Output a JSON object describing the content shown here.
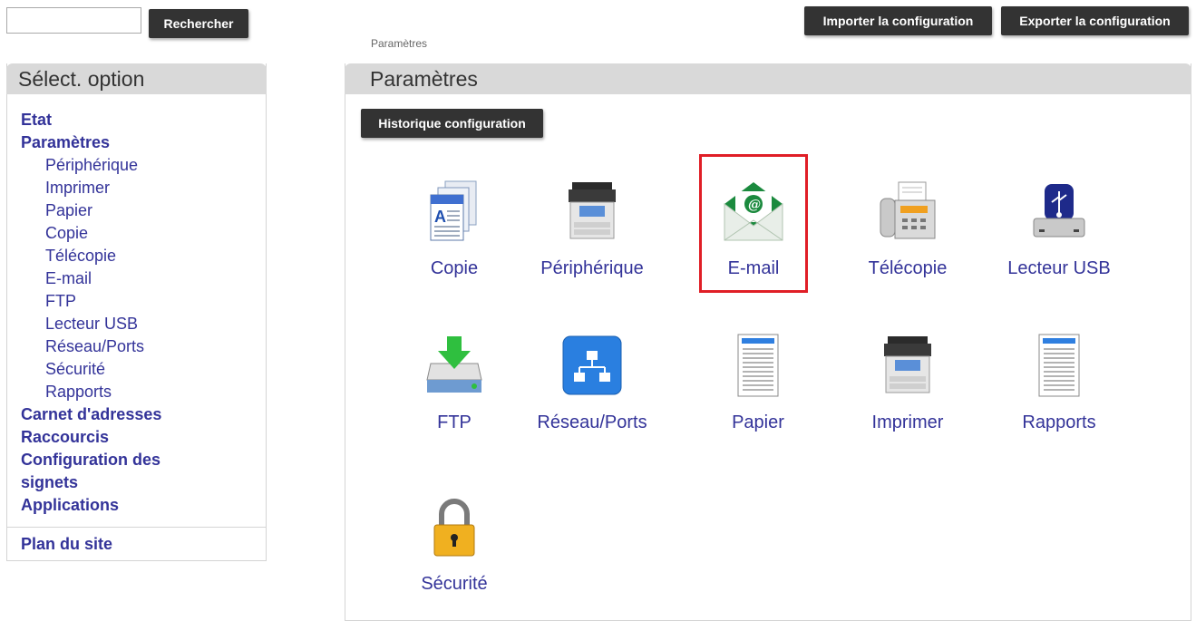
{
  "search": {
    "value": "",
    "button_label": "Rechercher"
  },
  "toolbar": {
    "import_label": "Importer la configuration",
    "export_label": "Exporter la configuration"
  },
  "breadcrumb": "Paramètres",
  "sidebar": {
    "title": "Sélect. option",
    "items": [
      {
        "label": "Etat",
        "level": 1
      },
      {
        "label": "Paramètres",
        "level": 1
      },
      {
        "label": "Périphérique",
        "level": 2
      },
      {
        "label": "Imprimer",
        "level": 2
      },
      {
        "label": "Papier",
        "level": 2
      },
      {
        "label": "Copie",
        "level": 2
      },
      {
        "label": "Télécopie",
        "level": 2
      },
      {
        "label": "E-mail",
        "level": 2
      },
      {
        "label": "FTP",
        "level": 2
      },
      {
        "label": "Lecteur USB",
        "level": 2
      },
      {
        "label": "Réseau/Ports",
        "level": 2
      },
      {
        "label": "Sécurité",
        "level": 2
      },
      {
        "label": "Rapports",
        "level": 2
      },
      {
        "label": "Carnet d'adresses",
        "level": 1
      },
      {
        "label": "Raccourcis",
        "level": 1
      },
      {
        "label": "Configuration des signets",
        "level": 1
      },
      {
        "label": "Applications",
        "level": 1
      }
    ],
    "sitemap_label": "Plan du site"
  },
  "main": {
    "title": "Paramètres",
    "history_button_label": "Historique configuration",
    "tiles": [
      {
        "label": "Copie",
        "icon": "copy-document-icon"
      },
      {
        "label": "Périphérique",
        "icon": "mfp-device-icon"
      },
      {
        "label": "E-mail",
        "icon": "email-envelope-icon",
        "highlighted": true
      },
      {
        "label": "Télécopie",
        "icon": "fax-machine-icon"
      },
      {
        "label": "Lecteur USB",
        "icon": "usb-drive-icon"
      },
      {
        "label": "FTP",
        "icon": "ftp-download-icon"
      },
      {
        "label": "Réseau/Ports",
        "icon": "network-ports-icon"
      },
      {
        "label": "Papier",
        "icon": "paper-document-icon"
      },
      {
        "label": "Imprimer",
        "icon": "printer-icon"
      },
      {
        "label": "Rapports",
        "icon": "report-document-icon"
      },
      {
        "label": "Sécurité",
        "icon": "padlock-icon"
      }
    ]
  },
  "colors": {
    "link": "#333399",
    "button_bg": "#333333",
    "header_bg": "#d9d9d9",
    "highlight": "#e01e26"
  }
}
